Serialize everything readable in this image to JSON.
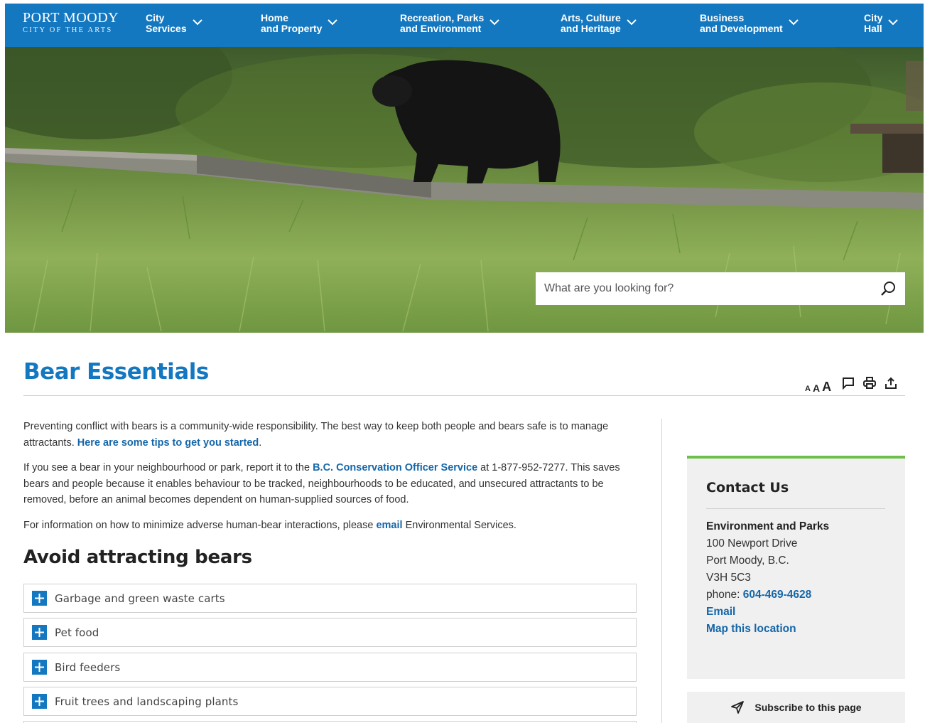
{
  "header": {
    "logo_line1": "PORT MOODY",
    "logo_line2": "CITY OF THE ARTS",
    "nav": [
      {
        "label": "City\nServices"
      },
      {
        "label": "Home\nand Property"
      },
      {
        "label": "Recreation, Parks\nand Environment"
      },
      {
        "label": "Arts, Culture\nand Heritage"
      },
      {
        "label": "Business\nand Development"
      },
      {
        "label": "City\nHall"
      }
    ]
  },
  "search": {
    "placeholder": "What are you looking for?"
  },
  "page": {
    "title": "Bear Essentials",
    "tools": {
      "font_small": "A",
      "font_medium": "A",
      "font_large": "A"
    }
  },
  "content": {
    "p1_text": "Preventing conflict with bears is a community-wide responsibility. The best way to keep both people and bears safe is to manage attractants. ",
    "p1_link": "Here are some tips to get you started",
    "p1_end": ".",
    "p2_start": "If you see a bear in your neighbourhood or park, report it to the ",
    "p2_link": "B.C. Conservation Officer Service",
    "p2_end": " at 1-877-952-7277. This saves bears and people because it enables behaviour to be tracked, neighbourhoods to be educated, and unsecured attractants to be removed, before an animal becomes dependent on human-supplied sources of food.",
    "p3_start": "For information on how to minimize adverse human-bear interactions, please ",
    "p3_link": "email",
    "p3_end": " Environmental Services.",
    "section_heading": "Avoid attracting bears",
    "accordion": [
      {
        "label": "Garbage and green waste carts"
      },
      {
        "label": "Pet food"
      },
      {
        "label": "Bird feeders"
      },
      {
        "label": "Fruit trees and landscaping plants"
      }
    ]
  },
  "sidebar": {
    "contact_heading": "Contact Us",
    "org": "Environment and Parks",
    "address1": "100 Newport Drive",
    "address2": "Port Moody, B.C.",
    "postal": "V3H 5C3",
    "phone_label": "phone: ",
    "phone": "604-469-4628",
    "email_link": "Email",
    "map_link": "Map this location",
    "subscribe_label": "Subscribe to this page"
  },
  "colors": {
    "brand_blue": "#1478c1",
    "link_blue": "#1466a9",
    "accent_green": "#6cc04a"
  },
  "icons": [
    "chevron-down-icon",
    "search-icon",
    "comment-icon",
    "print-icon",
    "share-icon",
    "plus-icon",
    "send-icon"
  ]
}
